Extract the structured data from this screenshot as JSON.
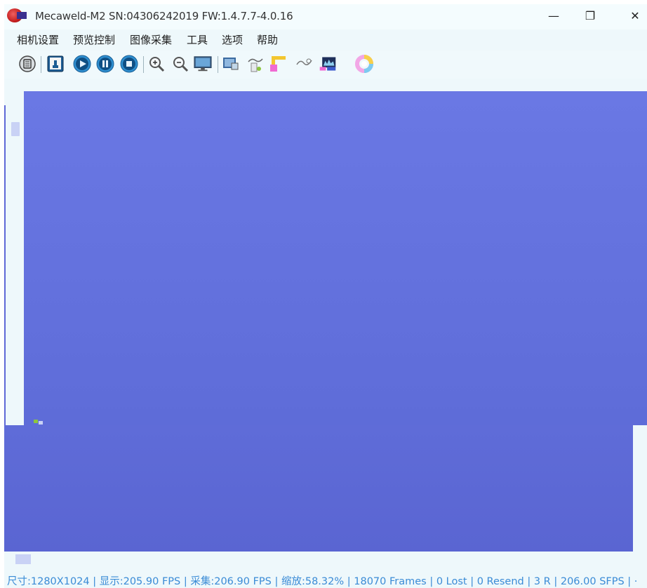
{
  "window": {
    "title": "Mecaweld-M2 SN:04306242019 FW:1.4.7.7-4.0.16",
    "min_glyph": "—",
    "max_glyph": "❐",
    "close_glyph": "✕"
  },
  "menu": {
    "items": [
      "相机设置",
      "预览控制",
      "图像采集",
      "工具",
      "选项",
      "帮助"
    ]
  },
  "toolbar": {
    "buttons": [
      "camera-list-icon",
      "camera-open-icon",
      "play-icon",
      "pause-icon",
      "stop-icon",
      "zoom-in-icon",
      "zoom-out-icon",
      "monitor-icon",
      "image-process-icon",
      "calibrate-icon",
      "ruler-icon",
      "network-icon",
      "histogram-icon",
      "color-wheel-icon"
    ]
  },
  "statusbar": {
    "text": "尺寸:1280X1024 | 显示:205.90 FPS | 采集:206.90 FPS | 缩放:58.32% | 18070 Frames | 0 Lost | 0 Resend | 3 R | 206.00 SFPS | ·"
  },
  "colors": {
    "accent": "#3a8bd6",
    "image_fill": "#6371dd",
    "window_bg": "#eef8fb"
  }
}
